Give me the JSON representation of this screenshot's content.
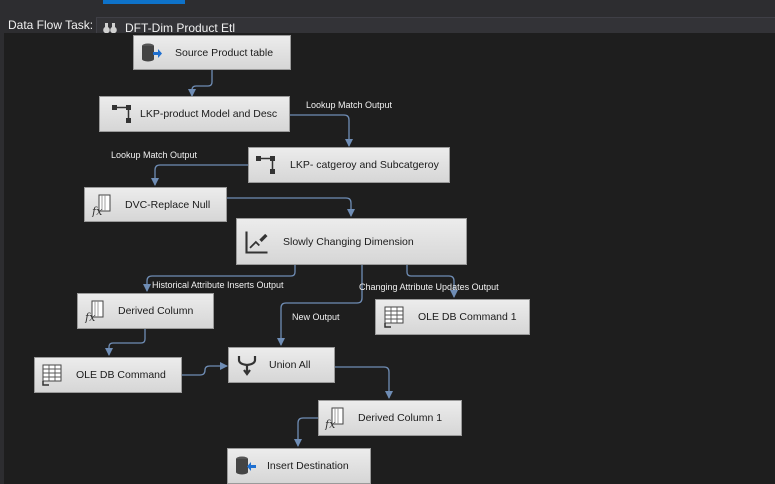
{
  "toolbar": {
    "task_label": "Data Flow Task:",
    "task_value": "DFT-Dim Product Etl"
  },
  "nodes": {
    "source": "Source Product table",
    "lkp_model": "LKP-product Model and Desc",
    "lkp_category": "LKP- catgeroy and Subcatgeroy",
    "dvc": "DVC-Replace Null",
    "scd": "Slowly Changing Dimension",
    "derived": "Derived Column",
    "oledb_update": "OLE DB Command 1",
    "oledb": "OLE DB Command",
    "union": "Union All",
    "derived1": "Derived Column 1",
    "insert": "Insert Destination"
  },
  "edges": {
    "lookup_match_1": "Lookup Match Output",
    "lookup_match_2": "Lookup Match Output",
    "historical": "Historical Attribute Inserts Output",
    "changing": "Changing Attribute Updates Output",
    "new_output": "New Output"
  },
  "colors": {
    "canvas": "#1e1e1e",
    "node_fill": "#e3e3e3",
    "connector": "#6f8db5",
    "accent": "#0e72c9"
  }
}
